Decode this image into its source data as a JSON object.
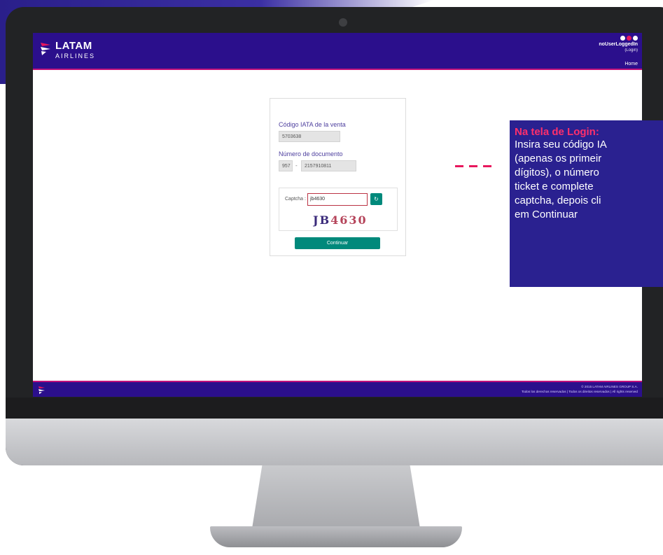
{
  "header": {
    "logo_main": "LATAM",
    "logo_sub": "AIRLINES",
    "user_name": "noUserLoggedIn",
    "user_login": "(Login)",
    "nav_home": "Home"
  },
  "form": {
    "iata_label": "Código IATA de la venta",
    "iata_value": "5703638",
    "doc_label": "Número de documento",
    "doc_prefix": "957",
    "doc_separator": "-",
    "doc_number": "2157910811",
    "captcha_label": "Captcha :",
    "captcha_value": "jb4630",
    "captcha_image_text": "JB4630",
    "refresh_icon": "↻",
    "continue_label": "Continuar"
  },
  "footer": {
    "copyright": "© 2015 LATAM AIRLINES GROUP S.A.",
    "rights": "Todos los derechos reservados | Todos os direitos reservados | All rights reserved"
  },
  "callout": {
    "title": "Na tela de Login:",
    "lines": [
      "Insira seu código IA",
      "(apenas os primeir",
      "dígitos), o número",
      "ticket e complete",
      "captcha, depois cli",
      "em Continuar"
    ]
  },
  "colors": {
    "brand": "#2b0f8c",
    "accent": "#c0117a",
    "button": "#00897b",
    "callout_bg": "#2a2190",
    "callout_title": "#ff2f6c"
  }
}
